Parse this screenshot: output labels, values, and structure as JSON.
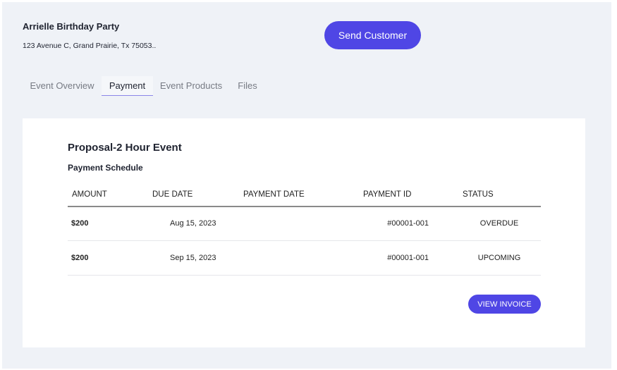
{
  "event": {
    "title": "Arrielle Birthday Party",
    "address": "123 Avenue C, Grand Prairie, Tx 75053.."
  },
  "send_button": "Send Customer",
  "tabs": [
    {
      "label": "Event Overview"
    },
    {
      "label": "Payment",
      "active": true
    },
    {
      "label": "Event Products"
    },
    {
      "label": "Files"
    }
  ],
  "proposal": {
    "title": "Proposal-2 Hour Event",
    "subtitle": "Payment Schedule"
  },
  "table": {
    "headers": [
      "AMOUNT",
      "DUE DATE",
      "PAYMENT DATE",
      "PAYMENT ID",
      "STATUS"
    ],
    "rows": [
      {
        "amount": "$200",
        "due_date": "Aug 15, 2023",
        "payment_date": "",
        "payment_id": "#00001-001",
        "status": "OVERDUE"
      },
      {
        "amount": "$200",
        "due_date": "Sep 15, 2023",
        "payment_date": "",
        "payment_id": "#00001-001",
        "status": "UPCOMING"
      }
    ]
  },
  "view_invoice": "VIEW INVOICE",
  "colors": {
    "accent": "#4f46e5",
    "background": "#eff2f7"
  }
}
